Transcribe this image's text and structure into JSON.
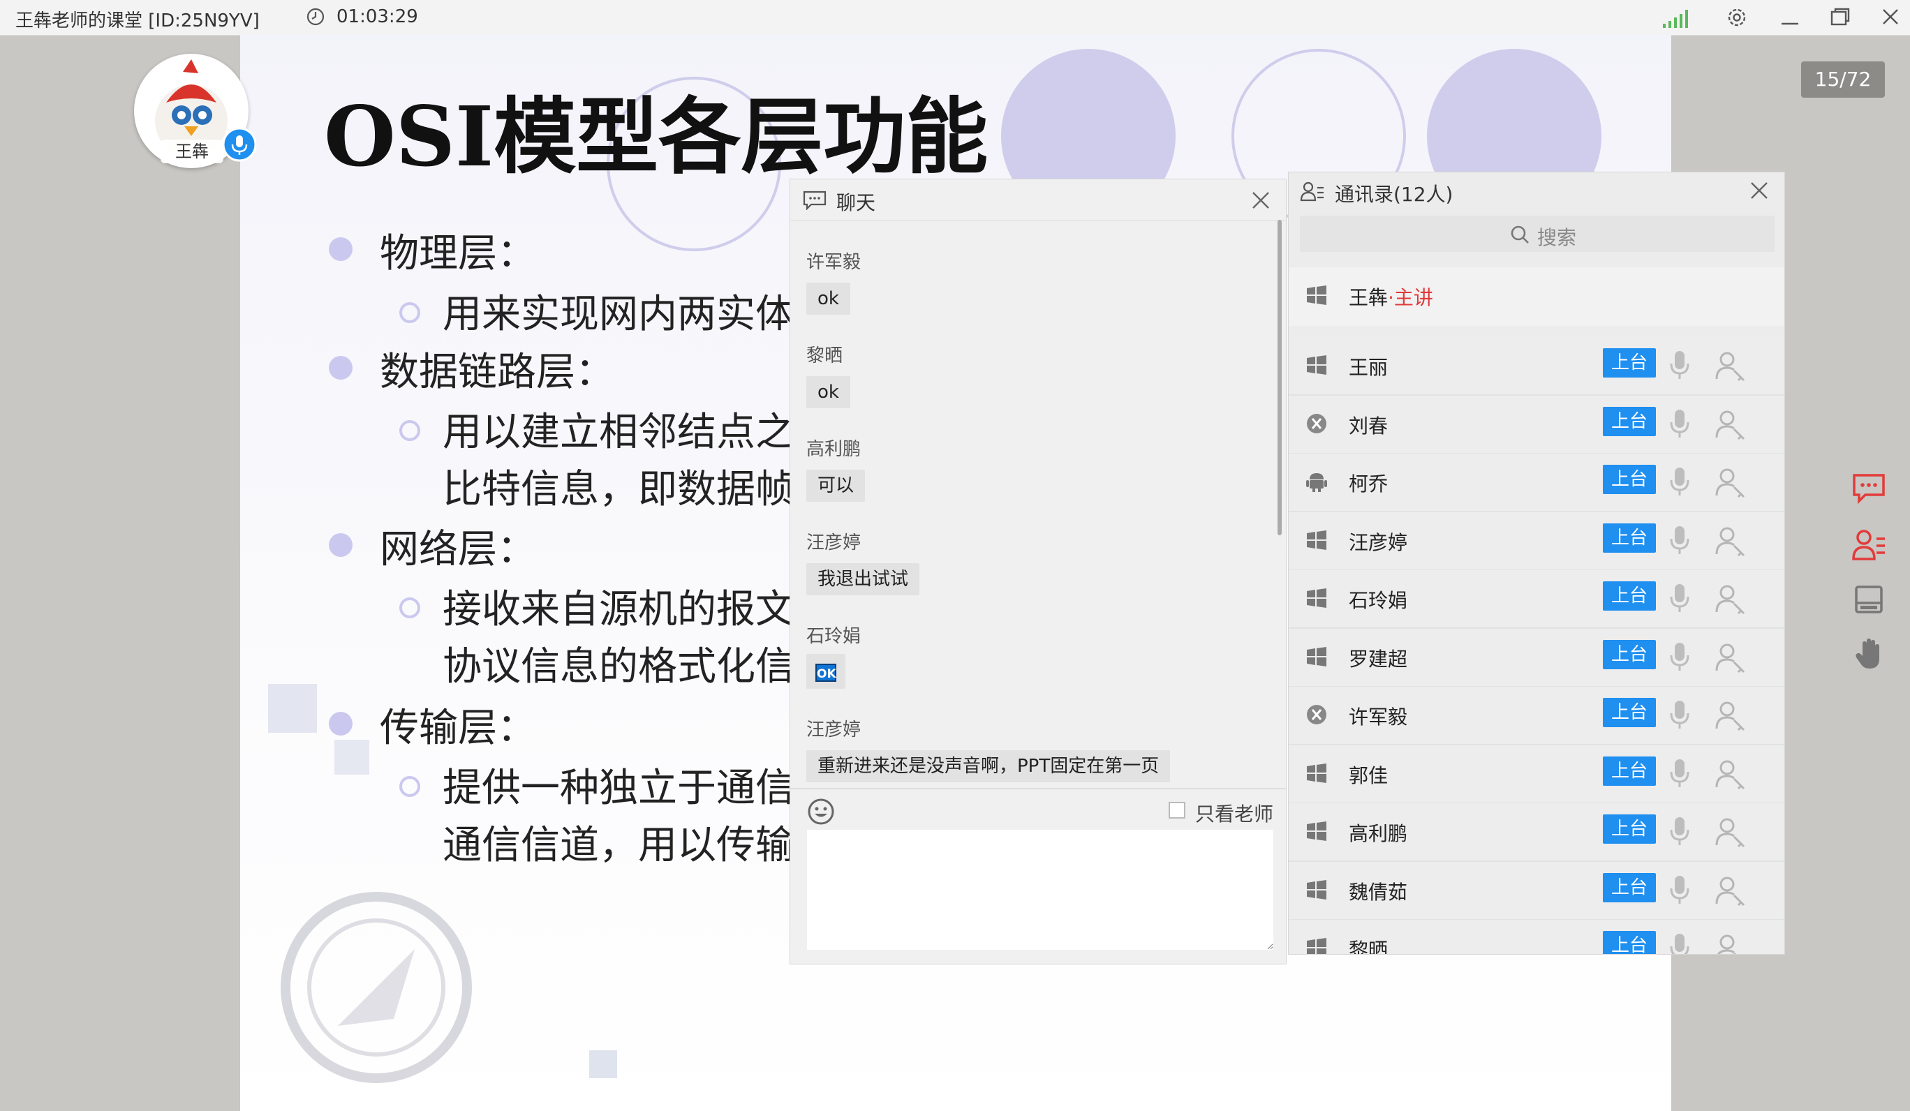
{
  "window": {
    "title": "王犇老师的课堂  [ID:25N9YV]",
    "elapsed_time": "01:03:29"
  },
  "slide": {
    "title": "OSI模型各层功能",
    "page_indicator": "15/72",
    "bullets": [
      {
        "level": 1,
        "text": "物理层："
      },
      {
        "level": 2,
        "text": "用来实现网内两实体"
      },
      {
        "level": 1,
        "text": "数据链路层："
      },
      {
        "level": 2,
        "text": "用以建立相邻结点之"
      },
      {
        "level": 3,
        "text": "比特信息，即数据帧"
      },
      {
        "level": 1,
        "text": "网络层："
      },
      {
        "level": 2,
        "text": "接收来自源机的报文"
      },
      {
        "level": 3,
        "text": "协议信息的格式化信"
      },
      {
        "level": 1,
        "text": "传输层："
      },
      {
        "level": 2,
        "text": "提供一种独立于通信"
      },
      {
        "level": 3,
        "text": "通信信道，用以传输"
      }
    ]
  },
  "presenter": {
    "name": "王犇"
  },
  "chat": {
    "title": "聊天",
    "messages": [
      {
        "sender": "许军毅",
        "text": "ok"
      },
      {
        "sender": "黎晒",
        "text": "ok"
      },
      {
        "sender": "高利鹏",
        "text": "可以"
      },
      {
        "sender": "汪彦婷",
        "text": "我退出试试"
      },
      {
        "sender": "石玲娟",
        "text": "OK"
      },
      {
        "sender": "汪彦婷",
        "text": "重新进来还是没声音啊，PPT固定在第一页"
      }
    ],
    "only_teacher_label": "只看老师",
    "input_value": ""
  },
  "contacts": {
    "title": "通讯录(12人)",
    "search_placeholder": "搜索",
    "host": {
      "name": "王犇",
      "tag": "·主讲",
      "os": "windows"
    },
    "stage_label": "上台",
    "members": [
      {
        "name": "王丽",
        "os": "windows"
      },
      {
        "name": "刘春",
        "os": "mac"
      },
      {
        "name": "柯乔",
        "os": "android"
      },
      {
        "name": "汪彦婷",
        "os": "windows"
      },
      {
        "name": "石玲娟",
        "os": "windows"
      },
      {
        "name": "罗建超",
        "os": "windows"
      },
      {
        "name": "许军毅",
        "os": "mac"
      },
      {
        "name": "郭佳",
        "os": "windows"
      },
      {
        "name": "高利鹏",
        "os": "windows"
      },
      {
        "name": "魏倩茹",
        "os": "windows"
      },
      {
        "name": "黎晒",
        "os": "windows"
      }
    ]
  },
  "colors": {
    "accent": "#1f8ff0",
    "host_tag": "#e03a3a",
    "sidebar_active": "#e23b3b",
    "signal": "#5cb85c"
  }
}
